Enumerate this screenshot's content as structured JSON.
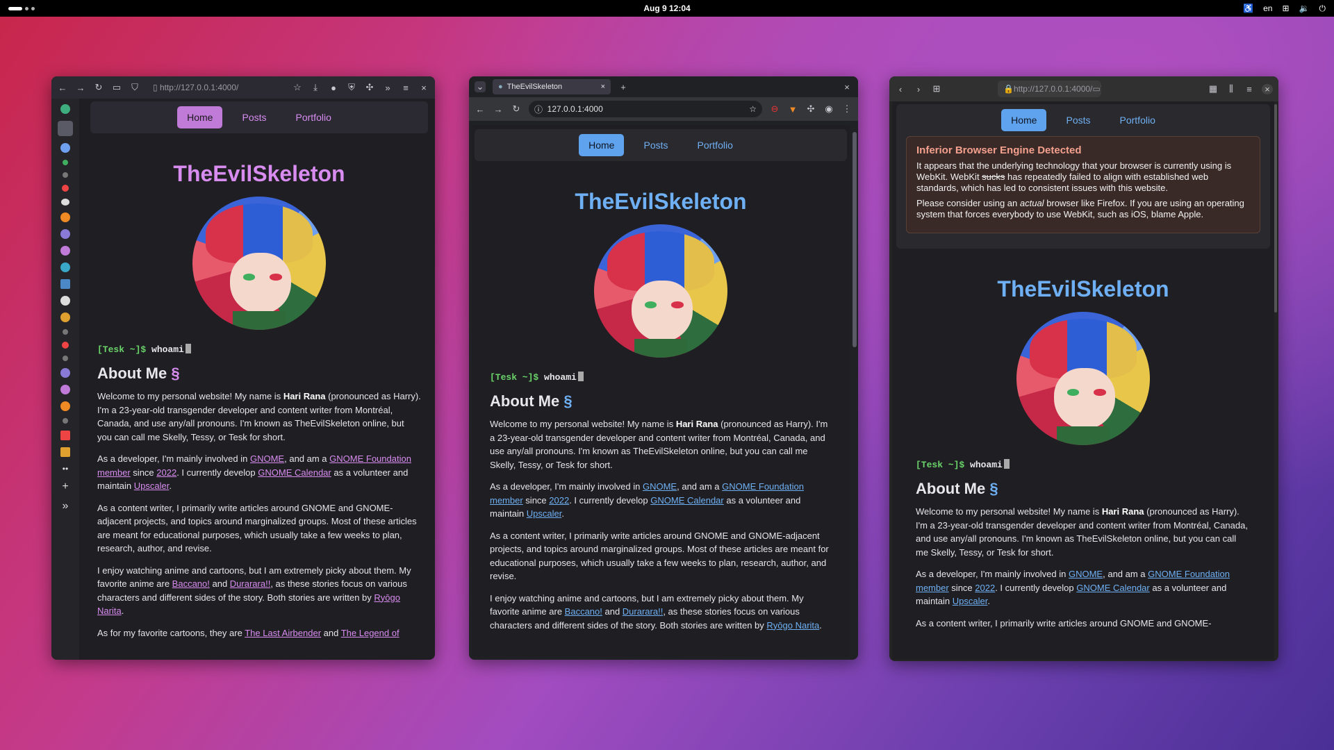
{
  "topbar": {
    "clock": "Aug 9  12:04",
    "lang": "en"
  },
  "site": {
    "nav": {
      "home": "Home",
      "posts": "Posts",
      "portfolio": "Portfolio"
    },
    "title": "TheEvilSkeleton",
    "prompt": "[Tesk ~]$",
    "command": "whoami",
    "about_heading": "About Me",
    "section_mark": "§",
    "p1": {
      "a": "Welcome to my personal website! My name is ",
      "name": "Hari Rana",
      "b": " (pronounced as Harry). I'm a 23-year-old transgender developer and content writer from Montréal, Canada, and use any/all pronouns. I'm known as TheEvilSkeleton online, but you can call me Skelly, Tessy, or Tesk for short."
    },
    "p2": {
      "a": "As a developer, I'm mainly involved in ",
      "gnome": "GNOME",
      "b": ", and am a ",
      "foundation": "GNOME Foundation member",
      "c": " since ",
      "year": "2022",
      "d": ". I currently develop ",
      "calendar": "GNOME Calendar",
      "e": " as a volunteer and maintain ",
      "upscaler": "Upscaler",
      "f": "."
    },
    "p3": "As a content writer, I primarily write articles around GNOME and GNOME-adjacent projects, and topics around marginalized groups. Most of these articles are meant for educational purposes, which usually take a few weeks to plan, research, author, and revise.",
    "p4": {
      "a": "I enjoy watching anime and cartoons, but I am extremely picky about them. My favorite anime are ",
      "baccano": "Baccano!",
      "b": " and ",
      "durarara": "Durarara!!",
      "c": ", as these stories focus on various characters and different sides of the story. Both stories are written by ",
      "author": "Ryōgo Narita",
      "d": "."
    },
    "p5": {
      "a": "As for my favorite cartoons, they are ",
      "tla": "The Last Airbender",
      "b": " and ",
      "tlo": "The Legend of"
    }
  },
  "win1": {
    "url": "http://127.0.0.1:4000/"
  },
  "win2": {
    "tab_title": "TheEvilSkeleton",
    "url": "127.0.0.1:4000"
  },
  "win3": {
    "url": "http://127.0.0.1:4000/",
    "alert": {
      "title": "Inferior Browser Engine Detected",
      "l1a": "It appears that the underlying technology that your browser is currently using is WebKit. WebKit ",
      "sucks": "sucks",
      "l1b": " has repeatedly failed to align with established web standards, which has led to consistent issues with this website.",
      "l2a": "Please consider using an ",
      "actual": "actual",
      "l2b": " browser like Firefox. If you are using an operating system that forces everybody to use WebKit, such as iOS, blame Apple."
    },
    "cutoff": "As a content writer, I primarily write articles around GNOME and GNOME-"
  },
  "colors": {
    "pink": "#d88cf0",
    "blue": "#6fb0f4",
    "terminal_green": "#6ad36a"
  }
}
